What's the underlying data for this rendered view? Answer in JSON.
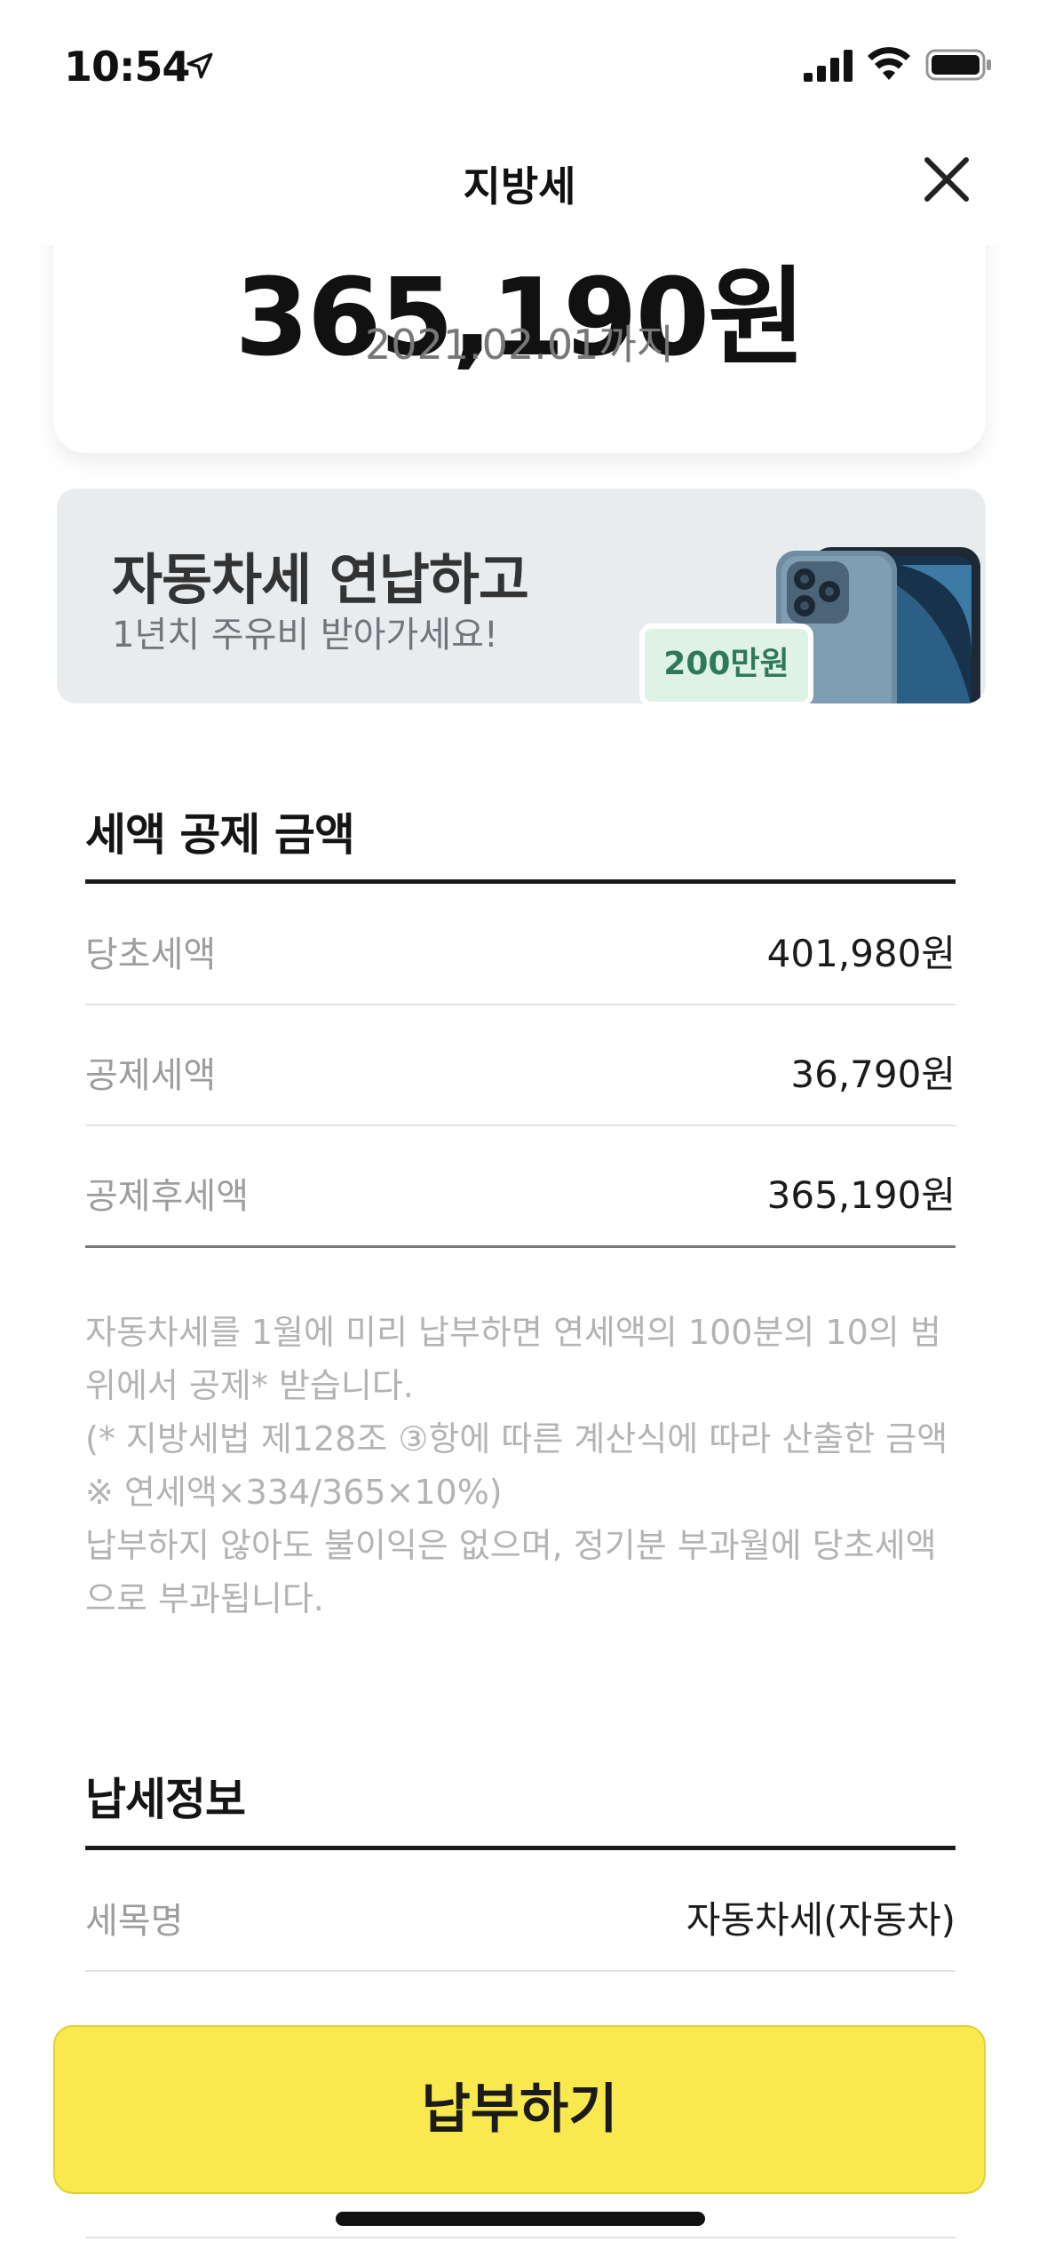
{
  "status_bar": {
    "time": "10:54"
  },
  "nav": {
    "title": "지방세"
  },
  "amount_card": {
    "amount": "365,190원",
    "due_date": "2021.02.01까지"
  },
  "banner": {
    "title": "자동차세 연납하고",
    "subtitle": "1년치 주유비 받아가세요!",
    "badge": "200만원"
  },
  "deduction": {
    "title": "세액 공제 금액",
    "rows": [
      {
        "label": "당초세액",
        "value": "401,980원"
      },
      {
        "label": "공제세액",
        "value": "36,790원"
      },
      {
        "label": "공제후세액",
        "value": "365,190원"
      }
    ],
    "notes": [
      "자동차세를 1월에 미리 납부하면 연세액의 100분의 10의 범위에서 공제* 받습니다.",
      "(* 지방세법 제128조 ③항에 따른 계산식에 따라 산출한 금액※ 연세액×334/365×10%)",
      "납부하지 않아도 불이익은 없으며, 정기분 부과월에 당초세액으로 부과됩니다."
    ]
  },
  "tax_info": {
    "title": "납세정보",
    "rows": [
      {
        "label": "세목명",
        "value": "자동차세(자동차)"
      }
    ]
  },
  "pay_button": {
    "label": "납부하기"
  },
  "colors": {
    "accent": "#f9e84e",
    "badge_bg": "#dff2e6",
    "badge_text": "#2e7a57"
  }
}
